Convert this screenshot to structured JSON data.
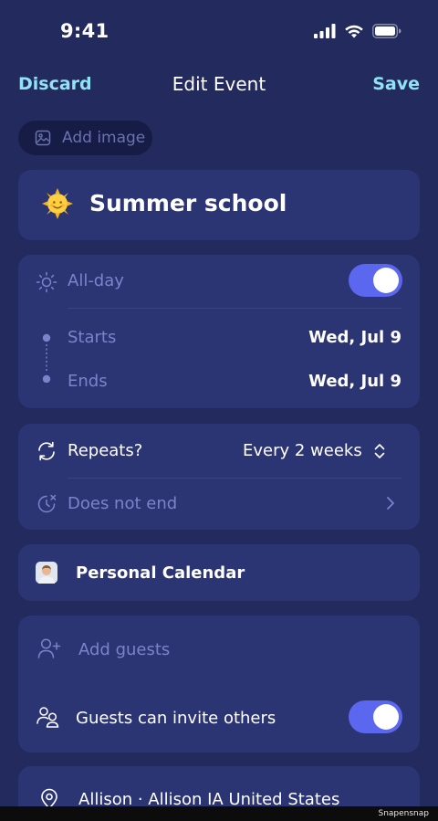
{
  "status_bar": {
    "time": "9:41"
  },
  "nav": {
    "discard": "Discard",
    "title": "Edit Event",
    "save": "Save"
  },
  "add_image": {
    "label": "Add image"
  },
  "event": {
    "title": "Summer school"
  },
  "time": {
    "all_day_label": "All-day",
    "all_day_on": true,
    "starts_label": "Starts",
    "starts_value": "Wed, Jul 9",
    "ends_label": "Ends",
    "ends_value": "Wed, Jul 9"
  },
  "repeat": {
    "repeats_label": "Repeats?",
    "repeats_value": "Every 2 weeks",
    "end_label": "Does not end"
  },
  "calendar": {
    "label": "Personal Calendar"
  },
  "guests": {
    "add_placeholder": "Add guests",
    "invite_label": "Guests can invite others",
    "invite_on": true
  },
  "location": {
    "value": "Allison · Allison IA United States"
  },
  "watermark": "Snapensnap",
  "colors": {
    "background": "#222a5e",
    "card": "#2c3574",
    "accent_link": "#8fe3f5",
    "toggle_on": "#5b67ef",
    "muted_text": "#7a84c8"
  }
}
